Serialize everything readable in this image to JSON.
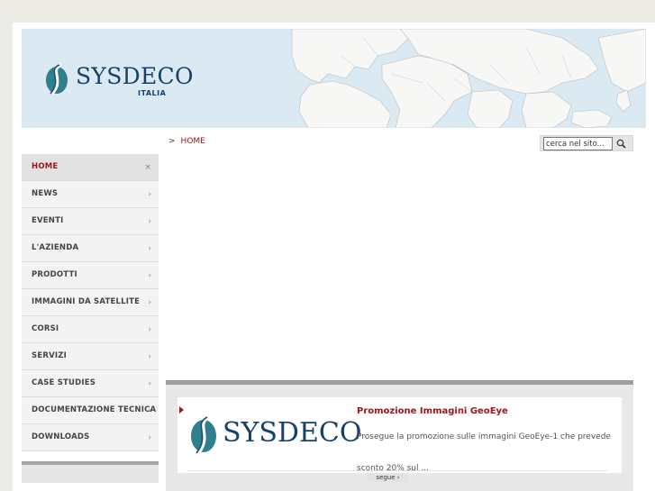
{
  "brand": {
    "name": "SYSDECO",
    "subtitle": "ITALIA"
  },
  "breadcrumb": {
    "separator": ">",
    "current": "HOME"
  },
  "search": {
    "placeholder": "cerca nel sito...",
    "icon": "magnifier-icon"
  },
  "nav": {
    "items": [
      {
        "label": "HOME",
        "active": true,
        "indicator": "×"
      },
      {
        "label": "NEWS",
        "indicator": "›"
      },
      {
        "label": "EVENTI",
        "indicator": "›"
      },
      {
        "label": "L'AZIENDA",
        "indicator": "›"
      },
      {
        "label": "PRODOTTI",
        "indicator": "›"
      },
      {
        "label": "IMMAGINI DA SATELLITE",
        "indicator": "›"
      },
      {
        "label": "CORSI",
        "indicator": "›"
      },
      {
        "label": "SERVIZI",
        "indicator": "›"
      },
      {
        "label": "CASE STUDIES",
        "indicator": "›"
      },
      {
        "label": "DOCUMENTAZIONE TECNICA",
        "indicator": "›"
      },
      {
        "label": "DOWNLOADS",
        "indicator": "›"
      }
    ]
  },
  "news": {
    "logo_text": "SYSDECO",
    "title": "Promozione Immagini GeoEye",
    "text": "Prosegue la promozione sulle immagini GeoEye-1 che prevede sconto 20% sul ...",
    "more_label": "segue ›"
  },
  "colors": {
    "accent": "#a0141c",
    "brand_blue": "#17406b",
    "map_water": "#dbe9f3"
  }
}
